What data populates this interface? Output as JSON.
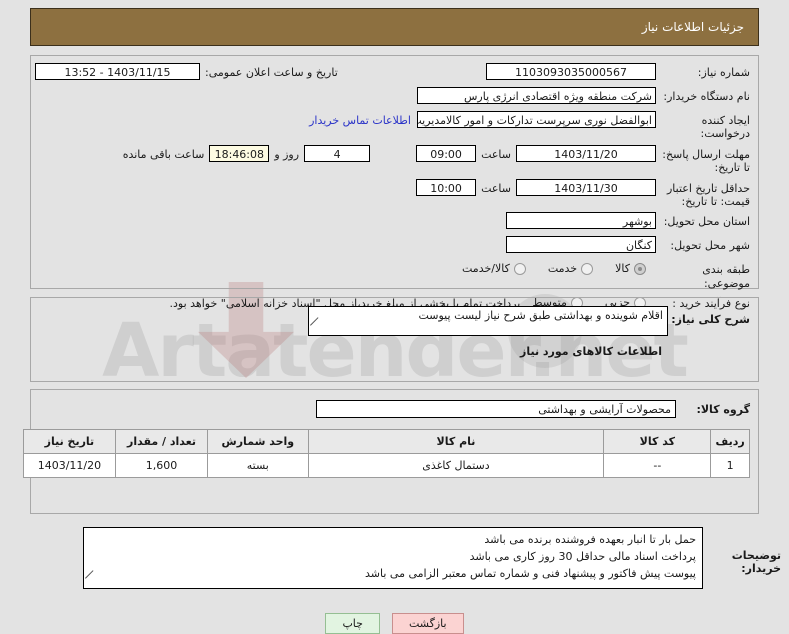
{
  "header": {
    "title": "جزئیات اطلاعات نیاز"
  },
  "watermark": {
    "text": "Artatender.net"
  },
  "info": {
    "need_number_label": "شماره نیاز:",
    "need_number_value": "1103093035000567",
    "announce_label": "تاریخ و ساعت اعلان عمومی:",
    "announce_value": "1403/11/15 - 13:52",
    "buyer_org_label": "نام دستگاه خریدار:",
    "buyer_org_value": "شرکت منطقه ویژه اقتصادی انرژی پارس",
    "creator_label": "ایجاد کننده درخواست:",
    "creator_value": "ابوالفضل نوری سرپرست تدارکات و امور کالامدیریت امور کنگان شرکت منطقه ویژ",
    "contact_link": "اطلاعات تماس خریدار",
    "response_deadline_label": "مهلت ارسال پاسخ: تا تاریخ:",
    "response_deadline_date": "1403/11/20",
    "response_time_label": "ساعت",
    "response_deadline_time": "09:00",
    "days_value": "4",
    "days_label": "روز و",
    "countdown_value": "18:46:08",
    "countdown_label": "ساعت باقی مانده",
    "price_validity_label": "حداقل تاریخ اعتبار قیمت: تا تاریخ:",
    "price_validity_date": "1403/11/30",
    "price_validity_time_label": "ساعت",
    "price_validity_time": "10:00",
    "province_label": "استان محل تحویل:",
    "province_value": "بوشهر",
    "city_label": "شهر محل تحویل:",
    "city_value": "کنگان",
    "category_label": "طبقه بندی موضوعی:",
    "category_options": [
      {
        "label": "کالا",
        "selected": true
      },
      {
        "label": "خدمت",
        "selected": false
      },
      {
        "label": "کالا/خدمت",
        "selected": false
      }
    ],
    "process_label": "نوع فرآیند خرید :",
    "process_options": [
      {
        "label": "جزیی",
        "selected": false
      },
      {
        "label": "متوسط",
        "selected": false
      }
    ],
    "payment_note": "پرداخت تمام یا بخشی از مبلغ خرید،از محل \"اسناد خزانه اسلامی\" خواهد بود."
  },
  "description": {
    "label": "شرح کلی نیاز:",
    "value": "اقلام شوینده و بهداشتی طبق شرح نیاز لیست پیوست"
  },
  "goods": {
    "section_title": "اطلاعات کالاهای مورد نیاز",
    "group_label": "گروه کالا:",
    "group_value": "محصولات آرایشی و بهداشتی",
    "columns": [
      "ردیف",
      "کد کالا",
      "نام کالا",
      "واحد شمارش",
      "تعداد / مقدار",
      "تاریخ نیاز"
    ],
    "rows": [
      {
        "index": "1",
        "code": "--",
        "name": "دستمال کاغذی",
        "unit": "بسته",
        "quantity": "1,600",
        "need_date": "1403/11/20"
      }
    ]
  },
  "notes": {
    "label": "توضیحات خریدار:",
    "line1": "حمل بار تا انبار بعهده فروشنده برنده می باشد",
    "line2": "پرداخت اسناد مالی حداقل 30 روز کاری می باشد",
    "line3": "پیوست پیش فاکتور و پیشنهاد فنی  و شماره تماس معتبر  الزامی می باشد"
  },
  "buttons": {
    "back": "بازگشت",
    "print": "چاپ"
  },
  "colors": {
    "header_bg": "#8d7040",
    "page_bg": "#e3e3e3",
    "link": "#2b34c8",
    "back_btn": "#fbd3d2",
    "print_btn": "#e2f4e1",
    "highlight_field": "#fdfbe2"
  }
}
